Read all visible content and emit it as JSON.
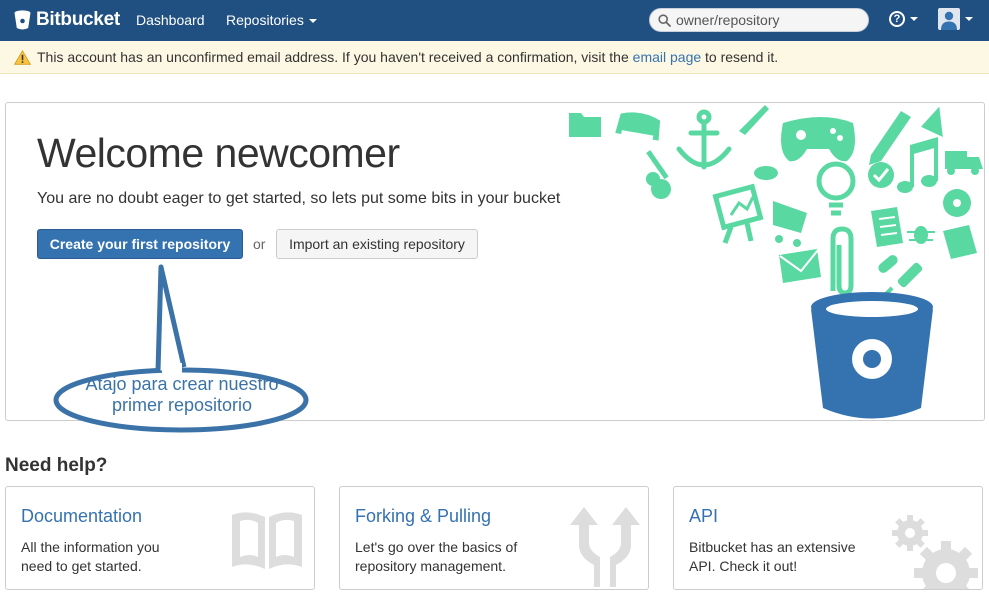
{
  "header": {
    "logo_text": "Bitbucket",
    "nav": {
      "dashboard": "Dashboard",
      "repositories": "Repositories"
    },
    "search": {
      "value": "owner/repository"
    },
    "help_glyph": "?",
    "brand_color": "#205081"
  },
  "alert": {
    "text_before": "This account has an unconfirmed email address. If you haven't received a confirmation, visit the ",
    "link": "email page",
    "text_after": " to resend it.",
    "icon": "warning-icon"
  },
  "welcome": {
    "title": "Welcome newcomer",
    "lead": "You are no doubt eager to get started, so lets put some bits in your bucket",
    "primary_button": "Create your first repository",
    "or": "or",
    "secondary_button": "Import an existing repository",
    "accent_color": "#3572b0",
    "illustration_color": "#59d8a1"
  },
  "callout": {
    "line1": "Atajo para crear nuestro",
    "line2": "primer repositorio"
  },
  "help": {
    "title": "Need help?",
    "cards": [
      {
        "title": "Documentation",
        "body": "All the information you need to get started.",
        "icon": "book-icon"
      },
      {
        "title": "Forking & Pulling",
        "body": "Let's go over the basics of repository management.",
        "icon": "fork-arrows-icon"
      },
      {
        "title": "API",
        "body": "Bitbucket has an extensive API. Check it out!",
        "icon": "gears-icon"
      }
    ]
  }
}
